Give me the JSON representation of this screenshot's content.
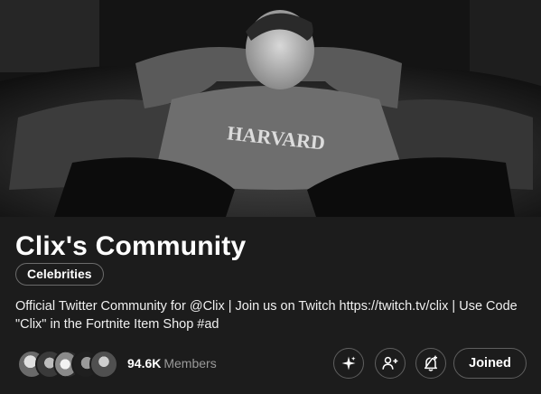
{
  "community": {
    "name": "Clix's Community",
    "category": "Celebrities",
    "description": "Official Twitter Community for @Clix | Join us on Twitch https://twitch.tv/clix | Use Code \"Clix\" in the Fortnite Item Shop #ad",
    "banner_image": "black-and-white photo of person leaning back on leather couch, wearing HARVARD sweatshirt",
    "banner_text": "HARVARD"
  },
  "members": {
    "count": "94.6K",
    "label": "Members",
    "avatars": [
      "member-avatar-1",
      "member-avatar-2",
      "member-avatar-3",
      "member-avatar-4",
      "member-avatar-5"
    ]
  },
  "actions": {
    "sparkle_icon": "sparkle-icon",
    "add_member_icon": "person-add-icon",
    "notifications_icon": "bell-plus-icon",
    "joined_label": "Joined"
  },
  "colors": {
    "background": "#1c1c1c",
    "text": "#ffffff",
    "muted": "#9a9a9a",
    "border": "#5f5f5f"
  }
}
